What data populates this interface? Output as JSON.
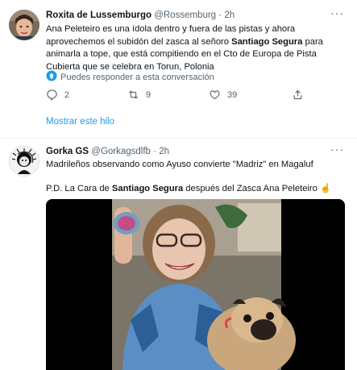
{
  "tweet1": {
    "display_name": "Roxita de Lussemburgo",
    "handle": "@Rossemburg",
    "separator": "·",
    "time": "2h",
    "text_part1": "Ana Peleteiro es una ídola dentro y fuera de las pistas y ahora aprovechemos el subidón del zasca al señoro ",
    "text_bold": "Santiago Segura",
    "text_part2": " para animarla a tope, que está compitiendo en el Cto de Europa de Pista Cubierta que se celebra en Torun, Polonia",
    "reply_note": "Puedes responder a esta conversación",
    "replies": "2",
    "retweets": "9",
    "likes": "39",
    "show_thread": "Mostrar este hilo"
  },
  "tweet2": {
    "display_name": "Gorka GS",
    "handle": "@Gorkagsdlfb",
    "separator": "·",
    "time": "2h",
    "line1": "Madrileños observando como Ayuso convierte \"Madriz\" en Magaluf",
    "line2_part1": "P.D. La Cara de ",
    "line2_bold": "Santiago Segura",
    "line2_part2": " después del Zasca Ana Peleteiro",
    "emoji": "☝"
  },
  "colors": {
    "accent": "#1d9bf0",
    "secondary_text": "#536471",
    "divider": "#eff3f4"
  }
}
